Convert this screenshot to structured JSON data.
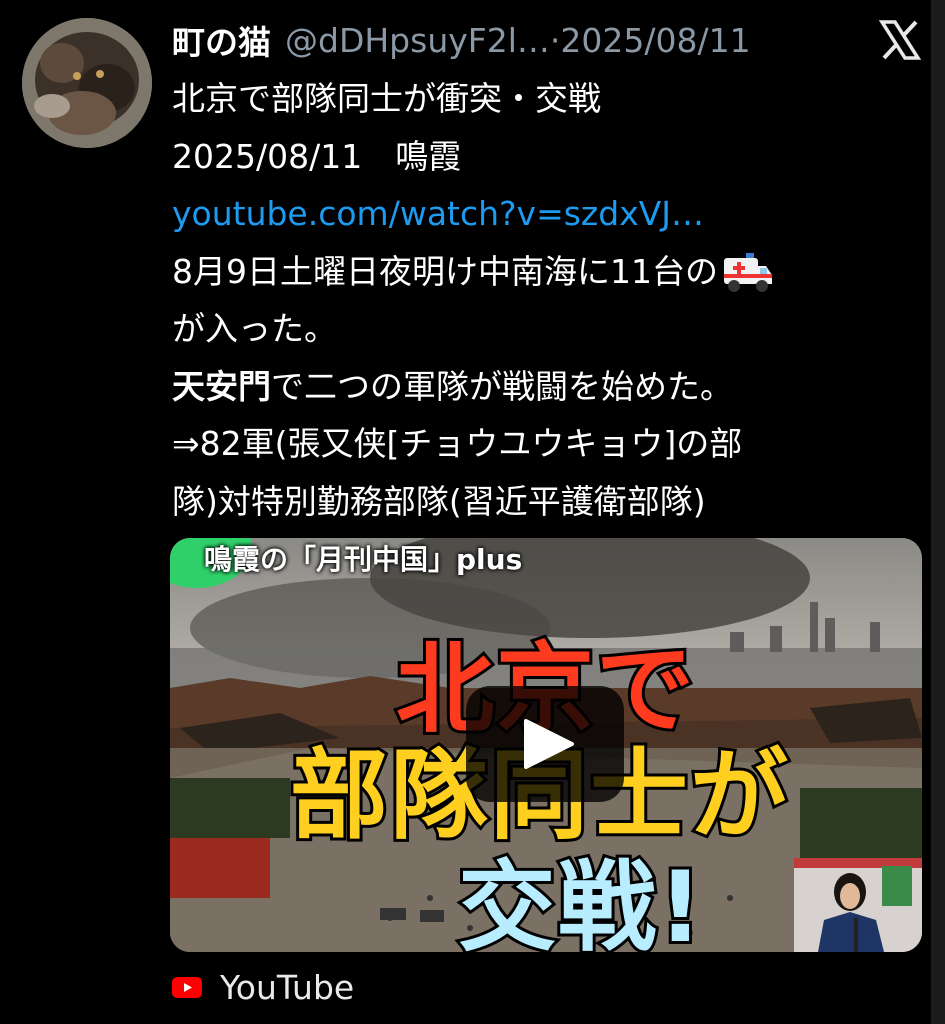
{
  "tweet": {
    "author_name": "町の猫",
    "handle": "@dDHpsuyF2l…",
    "separator": " · ",
    "date": "2025/08/11",
    "lines": [
      {
        "text": "北京で部隊同士が衝突・交戦"
      },
      {
        "text": "2025/08/11　鳴霞"
      },
      {
        "link": "youtube.com/watch?v=szdxVJ…"
      },
      {
        "text": "8月9日土曜日夜明け中南海に11台の",
        "emoji": "ambulance-icon"
      },
      {
        "text": "が入った。"
      },
      {
        "bold": "天安門",
        "rest": "で二つの軍隊が戦闘を始めた。"
      },
      {
        "text": "⇒82軍(張又侠[チョウユウキョウ]の部"
      },
      {
        "text": "隊)対特別勤務部隊(習近平護衛部隊)"
      }
    ]
  },
  "card": {
    "brand": "鳴霞の「月刊中国」plus",
    "headline_1": "北京で",
    "headline_2": "部隊同士が",
    "headline_3": "交戦!",
    "source": "YouTube"
  },
  "colors": {
    "link": "#1d9bf0",
    "headline_red": "#ff3b1f",
    "headline_yellow": "#ffcf1f",
    "headline_blue": "#b8ecff"
  }
}
